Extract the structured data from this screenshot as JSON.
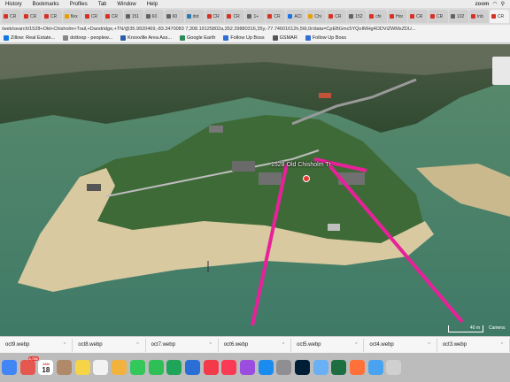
{
  "menubar": {
    "items": [
      "History",
      "Bookmarks",
      "Profiles",
      "Tab",
      "Window",
      "Help"
    ],
    "zoom_label": "zoom"
  },
  "tabs": [
    {
      "label": "CR",
      "color": "#d93025"
    },
    {
      "label": "CR",
      "color": "#d93025"
    },
    {
      "label": "CR",
      "color": "#d93025"
    },
    {
      "label": "flex",
      "color": "#e8a000"
    },
    {
      "label": "CR",
      "color": "#d93025"
    },
    {
      "label": "CR",
      "color": "#d93025"
    },
    {
      "label": "151",
      "color": "#5f6368"
    },
    {
      "label": "60",
      "color": "#5f6368"
    },
    {
      "label": "60",
      "color": "#5f6368"
    },
    {
      "label": "dot",
      "color": "#2a7ab0"
    },
    {
      "label": "CR",
      "color": "#d93025"
    },
    {
      "label": "CR",
      "color": "#d93025"
    },
    {
      "label": "1+",
      "color": "#5f6368"
    },
    {
      "label": "CR",
      "color": "#d93025"
    },
    {
      "label": "ACI",
      "color": "#1a73e8"
    },
    {
      "label": "Chi",
      "color": "#e8a000"
    },
    {
      "label": "CR",
      "color": "#d93025"
    },
    {
      "label": "152",
      "color": "#5f6368"
    },
    {
      "label": "chi",
      "color": "#d93025"
    },
    {
      "label": "Hor",
      "color": "#d93025"
    },
    {
      "label": "CR",
      "color": "#d93025"
    },
    {
      "label": "CR",
      "color": "#d93025"
    },
    {
      "label": "102",
      "color": "#5f6368"
    },
    {
      "label": "Inb",
      "color": "#d93025"
    },
    {
      "label": "CR",
      "color": "#d93025"
    }
  ],
  "address": {
    "url": "/web/search/1528+Old+Chisholm+Trail,+Dandridge,+TN/@35.9920469,-83.3470083 7,308.19125802a,352.39880316,35y,-77.74601612h,56t,0r/data=CpEBGmc5YQoIMHg4ODViZWMxZDU..."
  },
  "bookmarks": [
    {
      "label": "Zillow: Real Estate...",
      "color": "#1277e1"
    },
    {
      "label": "dottoop - peoplew...",
      "color": "#888888"
    },
    {
      "label": "Knoxville Area Ass...",
      "color": "#2a5ea8"
    },
    {
      "label": "Google Earth",
      "color": "#2e8b57"
    },
    {
      "label": "Follow Up Boss",
      "color": "#2f6fd6"
    },
    {
      "label": "GSMAR",
      "color": "#555555"
    },
    {
      "label": "Follow Up Boss",
      "color": "#2f6fd6"
    }
  ],
  "map": {
    "place_label": "1528 Old Chisholm Tr",
    "scale_label": "40 m",
    "camera_label": "Camera:",
    "boundary_color": "#e8219a"
  },
  "downloads": [
    {
      "label": "oct9.webp"
    },
    {
      "label": "oct8.webp"
    },
    {
      "label": "oct7.webp"
    },
    {
      "label": "oct6.webp"
    },
    {
      "label": "oct5.webp"
    },
    {
      "label": "oct4.webp"
    },
    {
      "label": "oct3.webp"
    }
  ],
  "dock": {
    "badge_count": "2,736",
    "calendar_month": "JAN",
    "calendar_day": "18",
    "apps": [
      {
        "name": "chrome-icon",
        "color": "#4285f4"
      },
      {
        "name": "photos-icon",
        "color": "#e5584f"
      },
      {
        "name": "calendar-icon",
        "color": "#ffffff"
      },
      {
        "name": "contacts-icon",
        "color": "#b08968"
      },
      {
        "name": "notes-icon",
        "color": "#f5d547"
      },
      {
        "name": "reminders-icon",
        "color": "#f2f2f2"
      },
      {
        "name": "photos2-icon",
        "color": "#f1b33d"
      },
      {
        "name": "messages-icon",
        "color": "#34c759"
      },
      {
        "name": "facetime-icon",
        "color": "#2fbf57"
      },
      {
        "name": "numbers-icon",
        "color": "#1fa55a"
      },
      {
        "name": "keynote-icon",
        "color": "#2b6fd6"
      },
      {
        "name": "news-icon",
        "color": "#f23a4a"
      },
      {
        "name": "music-icon",
        "color": "#fb3a55"
      },
      {
        "name": "podcasts-icon",
        "color": "#9b4de0"
      },
      {
        "name": "appstore-icon",
        "color": "#1a8cf0"
      },
      {
        "name": "settings-icon",
        "color": "#8e8e93"
      },
      {
        "name": "photoshop-icon",
        "color": "#001e36"
      },
      {
        "name": "preview-icon",
        "color": "#6ab0f5"
      },
      {
        "name": "excel-icon",
        "color": "#1d6f42"
      },
      {
        "name": "firefox-icon",
        "color": "#ff7139"
      },
      {
        "name": "finder-icon",
        "color": "#4aa3f0"
      },
      {
        "name": "trash-icon",
        "color": "#d0d0d0"
      }
    ]
  }
}
